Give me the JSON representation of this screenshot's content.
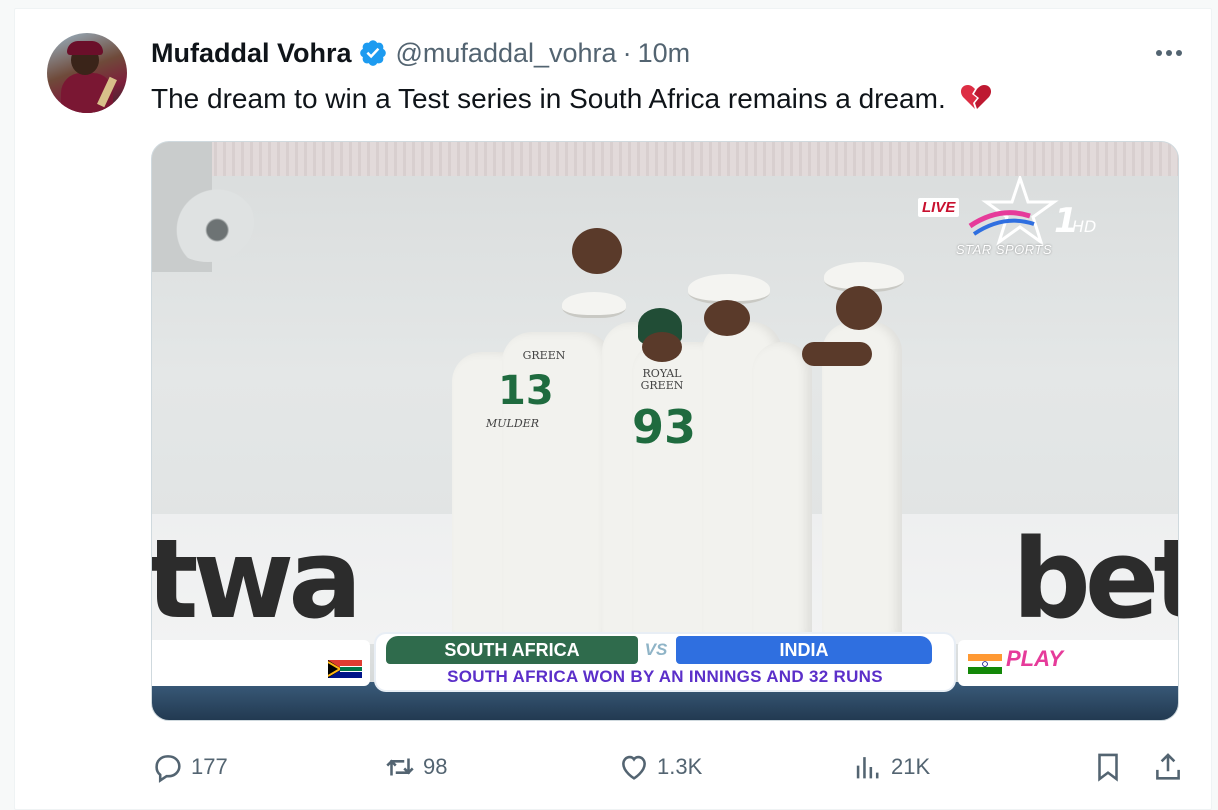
{
  "tweet": {
    "author_name": "Mufaddal Vohra",
    "handle": "@mufaddal_vohra",
    "separator": "·",
    "time": "10m",
    "text": "The dream to win a Test series in South Africa remains a dream.",
    "emoji_icon": "broken-heart-icon"
  },
  "media": {
    "broadcaster_live": "LIVE",
    "channel_number": "1",
    "channel_hd": "HD",
    "broadcaster_name": "STAR SPORTS",
    "ad_left": "twa",
    "ad_right": "bet",
    "jersey_numbers": [
      "13",
      "93"
    ],
    "jersey_names": [
      "GREEN",
      "ROYAL GREEN",
      "MULDER"
    ],
    "scoreboard": {
      "team_left": "SOUTH AFRICA",
      "versus": "VS",
      "team_right": "INDIA",
      "result": "SOUTH AFRICA WON BY  AN INNINGS AND 32 RUNS",
      "right_tag": "PLAY"
    }
  },
  "actions": {
    "replies": "177",
    "reposts": "98",
    "likes": "1.3K",
    "views": "21K"
  },
  "colors": {
    "verified": "#1d9bf0",
    "muted_text": "#536471",
    "sa_green": "#2f6b4c",
    "india_blue": "#2f6fe0",
    "result_purple": "#5b2fc9"
  }
}
